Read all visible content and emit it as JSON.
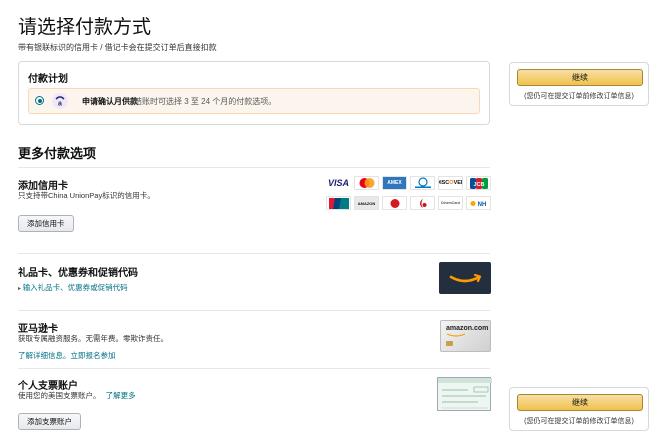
{
  "page": {
    "title": "请选择付款方式",
    "subtitle": "带有银联标识的信用卡 / 借记卡会在提交订单后直接扣款"
  },
  "plan": {
    "title": "付款计划",
    "option_strong": "申请确认月供款",
    "option_desc": "结账时可选择 3 至 24 个月的付款选项。"
  },
  "continue_panel": {
    "button_label": "继续",
    "note": "(您仍可在提交订单前修改订单信息)"
  },
  "more_options": {
    "title": "更多付款选项",
    "credit_card": {
      "title": "添加信用卡",
      "desc": "只支持带China UnionPay标识的信用卡。",
      "button": "添加信用卡",
      "logos": [
        "VISA",
        "MC",
        "AMEX",
        "Diners Club",
        "DISCOVER",
        "JCB",
        "UnionPay",
        "AMAZON",
        "",
        "",
        "DinersCard",
        "",
        "NH"
      ]
    },
    "gift": {
      "title": "礼品卡、优惠券和促销代码",
      "link": "输入礼品卡、优惠券或促销代码"
    },
    "amazon_card": {
      "title": "亚马逊卡",
      "desc": "获取专属融资服务。无需年费。零欺诈责任。",
      "link": "了解详细信息。立即报名参加",
      "card_text": "amazon.com"
    },
    "checking": {
      "title": "个人支票账户",
      "desc": "使用您的美国支票账户。",
      "link": "了解更多",
      "button": "添加支票账户"
    }
  },
  "colors": {
    "accent_link": "#007185",
    "button_yellow": "#f0c14b",
    "plan_bg": "#fcf5ee"
  }
}
